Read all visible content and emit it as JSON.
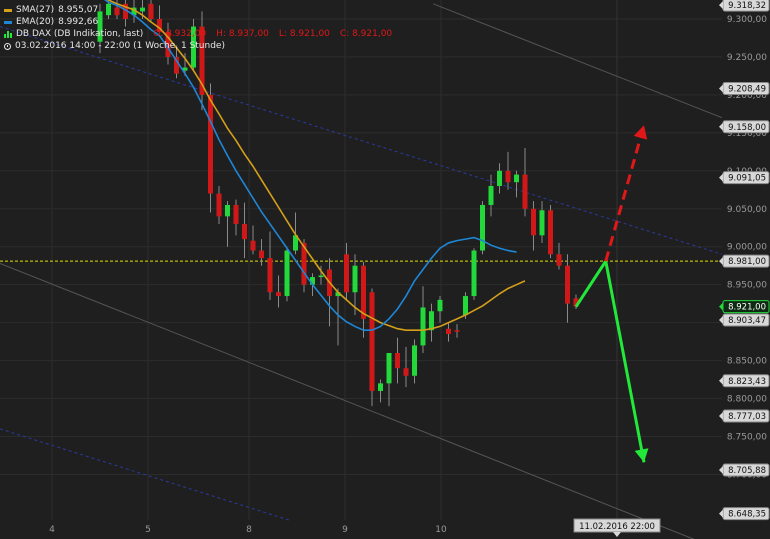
{
  "legend": {
    "sma_label": "SMA(27)",
    "sma_value": "8.955,07",
    "ema_label": "EMA(20)",
    "ema_value": "8.992,66",
    "instrument": "DB DAX (DB Indikation, last)",
    "open": "O: 8.932,00",
    "high": "H: 8.937,00",
    "low": "L: 8.921,00",
    "close": "C: 8.921,00",
    "timeframe": "03.02.2016 14:00 - 22:00 (1 Woche, 1 Stunde)"
  },
  "colors": {
    "background": "#1f1f1f",
    "up_candle": "#22d83a",
    "down_candle": "#d01818",
    "sma": "#d4a01a",
    "ema": "#1f86d6",
    "current_price_line": "#e8e000",
    "arrow_up": "#e01818",
    "arrow_down": "#22e83a",
    "trend_channel": "#555555",
    "trend_dashed": "#2a3aa0"
  },
  "chart_data": {
    "type": "candlestick",
    "ylim": [
      8640,
      9325
    ],
    "y_ticks": [
      8700,
      8750,
      8800,
      8850,
      8900,
      8950,
      9000,
      9050,
      9100,
      9150,
      9200,
      9250,
      9300
    ],
    "y_tick_labels": [
      "8.700,00",
      "8.750,00",
      "8.800,00",
      "8.850,00",
      "8.900,00",
      "8.950,00",
      "9.000,00",
      "9.050,00",
      "9.100,00",
      "9.150,00",
      "9.200,00",
      "9.250,00",
      "9.300,00"
    ],
    "x_ticks": [
      "4",
      "5",
      "8",
      "9",
      "10"
    ],
    "price_labels": [
      {
        "value": 9318.32,
        "label": "9.318,32",
        "style": "box"
      },
      {
        "value": 9208.49,
        "label": "9.208,49",
        "style": "box"
      },
      {
        "value": 9158.0,
        "label": "9.158,00",
        "style": "box"
      },
      {
        "value": 9091.05,
        "label": "9.091,05",
        "style": "box"
      },
      {
        "value": 8981.0,
        "label": "8.981,00",
        "style": "box"
      },
      {
        "value": 8921.0,
        "label": "8.921,00",
        "style": "current"
      },
      {
        "value": 8903.47,
        "label": "8.903,47",
        "style": "box"
      },
      {
        "value": 8823.43,
        "label": "8.823,43",
        "style": "box"
      },
      {
        "value": 8777.03,
        "label": "8.777,03",
        "style": "box"
      },
      {
        "value": 8705.88,
        "label": "8.705,88",
        "style": "box"
      },
      {
        "value": 8648.35,
        "label": "8.648,35",
        "style": "box"
      }
    ],
    "current_price": 8981.0,
    "crosshair_date": "11.02.2016 22:00",
    "candles": [
      {
        "o": 9270,
        "h": 9320,
        "l": 9255,
        "c": 9310
      },
      {
        "o": 9305,
        "h": 9325,
        "l": 9300,
        "c": 9320
      },
      {
        "o": 9315,
        "h": 9325,
        "l": 9300,
        "c": 9305
      },
      {
        "o": 9320,
        "h": 9325,
        "l": 9290,
        "c": 9300
      },
      {
        "o": 9305,
        "h": 9325,
        "l": 9295,
        "c": 9315
      },
      {
        "o": 9310,
        "h": 9325,
        "l": 9300,
        "c": 9315
      },
      {
        "o": 9320,
        "h": 9325,
        "l": 9295,
        "c": 9300
      },
      {
        "o": 9300,
        "h": 9318,
        "l": 9283,
        "c": 9283
      },
      {
        "o": 9283,
        "h": 9295,
        "l": 9240,
        "c": 9250
      },
      {
        "o": 9250,
        "h": 9265,
        "l": 9222,
        "c": 9228
      },
      {
        "o": 9232,
        "h": 9255,
        "l": 9225,
        "c": 9236
      },
      {
        "o": 9236,
        "h": 9300,
        "l": 9233,
        "c": 9290
      },
      {
        "o": 9290,
        "h": 9310,
        "l": 9180,
        "c": 9200
      },
      {
        "o": 9200,
        "h": 9215,
        "l": 9045,
        "c": 9070
      },
      {
        "o": 9070,
        "h": 9080,
        "l": 9030,
        "c": 9040
      },
      {
        "o": 9040,
        "h": 9060,
        "l": 9000,
        "c": 9055
      },
      {
        "o": 9055,
        "h": 9062,
        "l": 9015,
        "c": 9030
      },
      {
        "o": 9030,
        "h": 9058,
        "l": 8985,
        "c": 9010
      },
      {
        "o": 9008,
        "h": 9028,
        "l": 8990,
        "c": 8995
      },
      {
        "o": 8995,
        "h": 9010,
        "l": 8975,
        "c": 8985
      },
      {
        "o": 8985,
        "h": 9020,
        "l": 8930,
        "c": 8940
      },
      {
        "o": 8940,
        "h": 8962,
        "l": 8920,
        "c": 8935
      },
      {
        "o": 8935,
        "h": 9000,
        "l": 8928,
        "c": 8995
      },
      {
        "o": 8995,
        "h": 9045,
        "l": 8990,
        "c": 9015
      },
      {
        "o": 9005,
        "h": 9010,
        "l": 8940,
        "c": 8950
      },
      {
        "o": 8950,
        "h": 8965,
        "l": 8935,
        "c": 8960
      },
      {
        "o": 8960,
        "h": 8975,
        "l": 8950,
        "c": 8962
      },
      {
        "o": 8970,
        "h": 8985,
        "l": 8895,
        "c": 8935
      },
      {
        "o": 8935,
        "h": 8945,
        "l": 8870,
        "c": 8940
      },
      {
        "o": 8990,
        "h": 9005,
        "l": 8930,
        "c": 8940
      },
      {
        "o": 8940,
        "h": 8990,
        "l": 8910,
        "c": 8975
      },
      {
        "o": 8975,
        "h": 8980,
        "l": 8880,
        "c": 8905
      },
      {
        "o": 8940,
        "h": 8945,
        "l": 8790,
        "c": 8810
      },
      {
        "o": 8810,
        "h": 8825,
        "l": 8795,
        "c": 8820
      },
      {
        "o": 8820,
        "h": 8840,
        "l": 8790,
        "c": 8860
      },
      {
        "o": 8860,
        "h": 8880,
        "l": 8820,
        "c": 8840
      },
      {
        "o": 8840,
        "h": 8868,
        "l": 8815,
        "c": 8830
      },
      {
        "o": 8830,
        "h": 8878,
        "l": 8820,
        "c": 8870
      },
      {
        "o": 8870,
        "h": 8948,
        "l": 8860,
        "c": 8920
      },
      {
        "o": 8890,
        "h": 8925,
        "l": 8875,
        "c": 8915
      },
      {
        "o": 8915,
        "h": 8935,
        "l": 8900,
        "c": 8930
      },
      {
        "o": 8892,
        "h": 8900,
        "l": 8875,
        "c": 8885
      },
      {
        "o": 8890,
        "h": 8898,
        "l": 8880,
        "c": 8888
      },
      {
        "o": 8910,
        "h": 8940,
        "l": 8905,
        "c": 8935
      },
      {
        "o": 8935,
        "h": 8998,
        "l": 8930,
        "c": 8995
      },
      {
        "o": 8995,
        "h": 9060,
        "l": 8990,
        "c": 9055
      },
      {
        "o": 9055,
        "h": 9095,
        "l": 9040,
        "c": 9080
      },
      {
        "o": 9080,
        "h": 9110,
        "l": 9070,
        "c": 9100
      },
      {
        "o": 9100,
        "h": 9125,
        "l": 9075,
        "c": 9085
      },
      {
        "o": 9085,
        "h": 9100,
        "l": 9065,
        "c": 9095
      },
      {
        "o": 9095,
        "h": 9130,
        "l": 9040,
        "c": 9050
      },
      {
        "o": 9050,
        "h": 9060,
        "l": 8995,
        "c": 9015
      },
      {
        "o": 9015,
        "h": 9060,
        "l": 9005,
        "c": 9048
      },
      {
        "o": 9048,
        "h": 9055,
        "l": 8985,
        "c": 8990
      },
      {
        "o": 8990,
        "h": 9005,
        "l": 8970,
        "c": 8975
      },
      {
        "o": 8975,
        "h": 8990,
        "l": 8900,
        "c": 8925
      },
      {
        "o": 8932,
        "h": 8937,
        "l": 8918,
        "c": 8921
      }
    ],
    "sma": [
      9330,
      9325,
      9320,
      9316,
      9312,
      9305,
      9296,
      9288,
      9276,
      9262,
      9248,
      9232,
      9214,
      9193,
      9175,
      9156,
      9140,
      9122,
      9106,
      9088,
      9070,
      9052,
      9034,
      9016,
      9000,
      8984,
      8968,
      8953,
      8940,
      8930,
      8920,
      8912,
      8906,
      8900,
      8896,
      8892,
      8890,
      8890,
      8890,
      8892,
      8895,
      8900,
      8905,
      8910,
      8916,
      8922,
      8930,
      8938,
      8945,
      8950,
      8955
    ],
    "ema": [
      9330,
      9322,
      9318,
      9312,
      9305,
      9296,
      9286,
      9278,
      9262,
      9245,
      9228,
      9210,
      9188,
      9165,
      9141,
      9120,
      9100,
      9082,
      9064,
      9046,
      9030,
      9014,
      8998,
      8982,
      8966,
      8950,
      8936,
      8922,
      8910,
      8901,
      8895,
      8890,
      8890,
      8895,
      8905,
      8918,
      8935,
      8955,
      8970,
      8985,
      8998,
      9005,
      9008,
      9010,
      9012,
      9008,
      9002,
      8998,
      8995,
      8993
    ],
    "channels": [
      {
        "style": "solid",
        "from": [
          0.0,
          8978
        ],
        "to": [
          1.0,
          8600
        ]
      },
      {
        "style": "solid",
        "from": [
          0.6,
          9320
        ],
        "to": [
          1.0,
          9170
        ]
      },
      {
        "style": "dashed",
        "from": [
          0.0,
          9290
        ],
        "to": [
          1.0,
          8990
        ]
      },
      {
        "style": "dashed",
        "from": [
          0.0,
          8760
        ],
        "to": [
          0.4,
          8640
        ]
      }
    ],
    "projection": {
      "start": {
        "bar": 56,
        "value": 8921
      },
      "pivot": {
        "bar": 59.5,
        "value": 8981
      },
      "up_target": {
        "bar": 64,
        "value": 9160
      },
      "down_target": {
        "bar": 64,
        "value": 8716
      }
    }
  }
}
